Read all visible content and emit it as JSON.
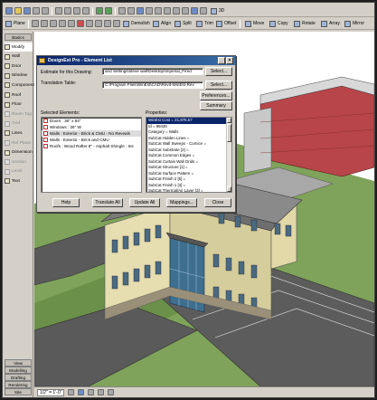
{
  "toolbar_top": {
    "plane_label": "Plane",
    "view_3d_label": "3D"
  },
  "toolbar_edit": {
    "items": [
      "Demolish",
      "Align",
      "Split",
      "Trim",
      "Offset",
      "Move",
      "Copy",
      "Rotate",
      "Array",
      "Mirror"
    ]
  },
  "palette": {
    "basics_tab": "Basics",
    "items": [
      {
        "label": "Modify",
        "state": "selected"
      },
      {
        "label": "Wall",
        "state": "normal"
      },
      {
        "label": "Door",
        "state": "normal"
      },
      {
        "label": "Window",
        "state": "normal"
      },
      {
        "label": "Component",
        "state": "normal"
      },
      {
        "label": "Roof",
        "state": "normal"
      },
      {
        "label": "Floor",
        "state": "normal"
      },
      {
        "label": "Room Tag",
        "state": "disabled"
      },
      {
        "label": "Grid",
        "state": "disabled"
      },
      {
        "label": "Lines",
        "state": "normal"
      },
      {
        "label": "Ref Plane",
        "state": "disabled"
      },
      {
        "label": "Dimension",
        "state": "normal"
      },
      {
        "label": "Section",
        "state": "disabled"
      },
      {
        "label": "Level",
        "state": "disabled"
      },
      {
        "label": "Text",
        "state": "normal"
      }
    ],
    "bottom_tabs": [
      "View",
      "Modelling",
      "Drafting",
      "Rendering",
      "Site"
    ]
  },
  "dialog": {
    "title": "DesignEst Pro - Element List",
    "estimate_label": "Estimate for this Drawing:",
    "estimate_value": "and Settings\\steve wall\\Desktop\\Imperial_Fired",
    "translation_label": "Translation Table:",
    "translation_value": "C:\\Program Files\\WinEst\\CAD\\Revit-WinEst-Rev",
    "select_label": "Select...",
    "preferences_label": "Preferences...",
    "summary_label": "Summary",
    "selected_elements_label": "Selected Elements:",
    "properties_label": "Properties:",
    "elements": [
      "Doors : 36\" x 84\"",
      "Windows : 26\" W",
      "Walls : Exterior - Brick & CMU - No Reveals",
      "Walls : Exterior - Brick and CMU",
      "Roofs : Wood Rafter 8\" - Asphalt Shingle : Ins"
    ],
    "selected_element_index": 2,
    "properties": [
      "WinEst Cost = 21,976.67",
      "Id = 98430",
      "Category = Walls",
      "SubCat Hidden Lines =",
      "SubCat Wall Sweeps - Cornice =",
      "SubCat Substrate [2] =",
      "SubCat Common Edges =",
      "SubCat Curtain Wall Grids =",
      "SubCat Structure [1] =",
      "SubCat Surface Pattern =",
      "SubCat Finish 2 [5] =",
      "SubCat Finish 1 [4] =",
      "SubCat Thermal/Air Layer [3] ="
    ],
    "buttons": [
      "Help",
      "Translate All",
      "Update All",
      "Mappings...",
      "Close"
    ]
  },
  "status": {
    "scale": "1/2\" = 1'-0\""
  }
}
